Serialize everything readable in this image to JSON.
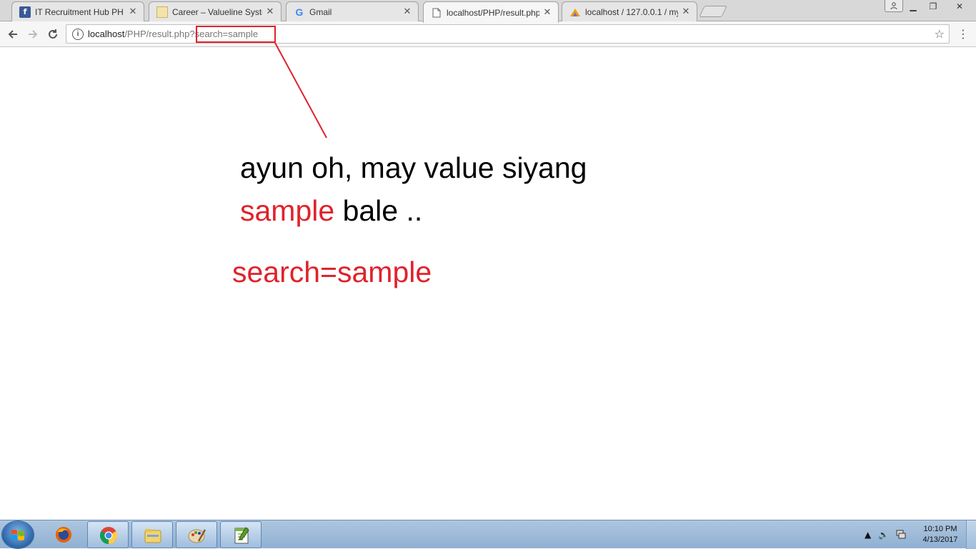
{
  "tabs": [
    {
      "title": "IT Recruitment Hub PH",
      "icon": "facebook-icon",
      "active": false
    },
    {
      "title": "Career – Valueline Systems",
      "icon": "valueline-icon",
      "active": false
    },
    {
      "title": "Gmail",
      "icon": "google-icon",
      "active": false
    },
    {
      "title": "localhost/PHP/result.php",
      "icon": "page-icon",
      "active": true
    },
    {
      "title": "localhost / 127.0.0.1 / my",
      "icon": "phpmyadmin-icon",
      "active": false
    }
  ],
  "address": {
    "host": "localhost",
    "path": "/PHP/result.php",
    "query": "?search=sample"
  },
  "content": {
    "line1": "ayun oh, may value siyang",
    "line2_highlight": "sample",
    "line2_rest": " bale ..",
    "line3": "search=sample"
  },
  "clock": {
    "time": "10:10 PM",
    "date": "4/13/2017"
  },
  "colors": {
    "annotation": "#e0222b"
  }
}
